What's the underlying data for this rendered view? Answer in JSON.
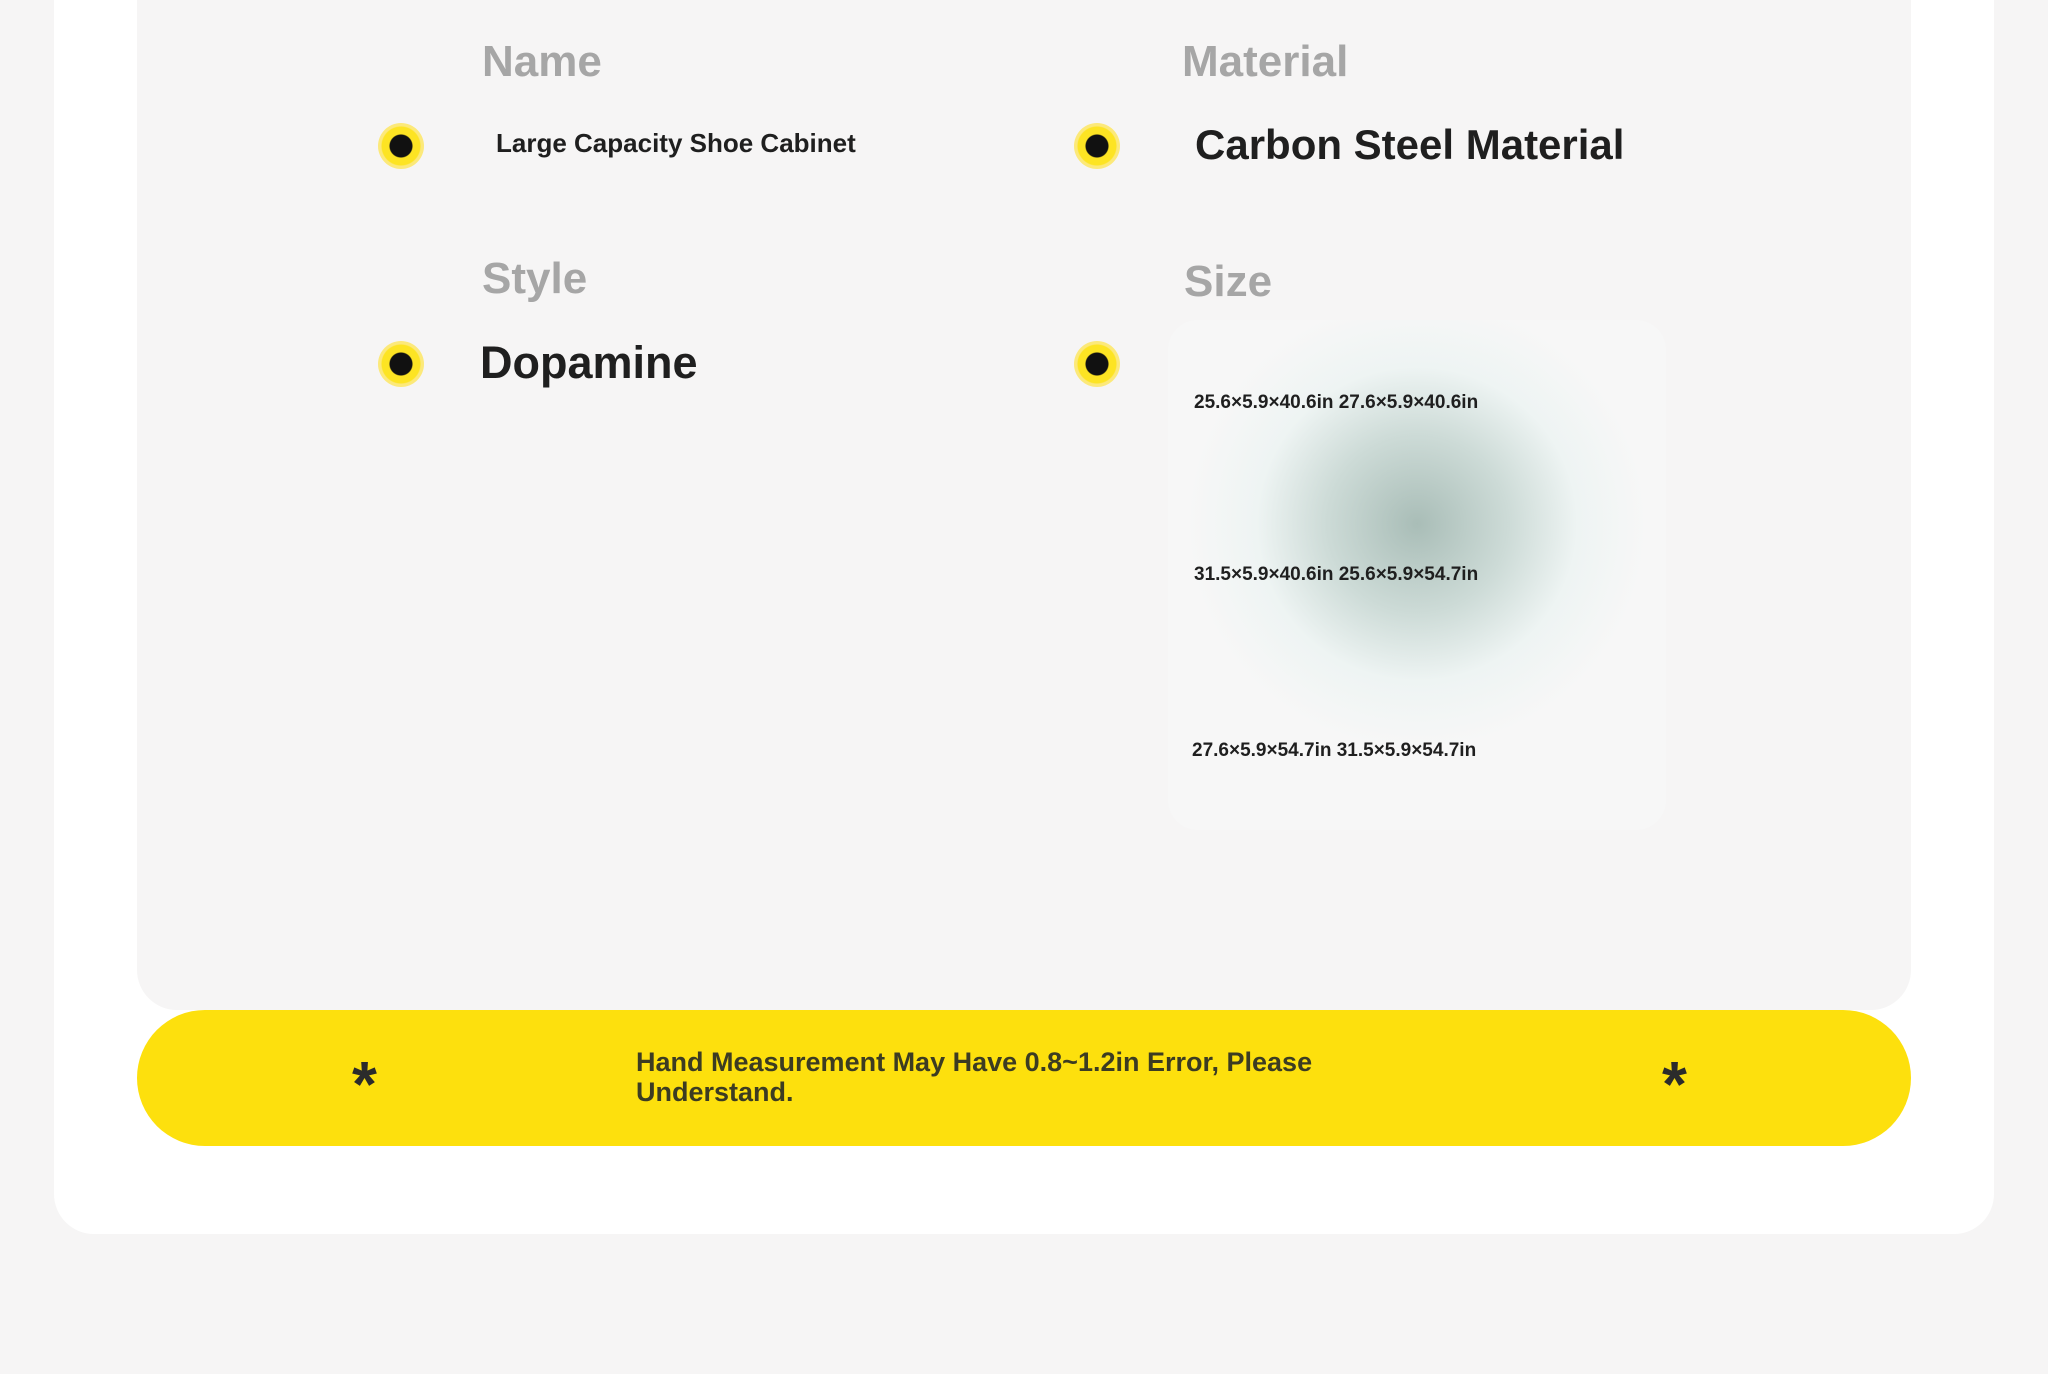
{
  "specs": {
    "name": {
      "label": "Name",
      "value": "Large Capacity Shoe Cabinet"
    },
    "material": {
      "label": "Material",
      "value": "Carbon Steel Material"
    },
    "style": {
      "label": "Style",
      "value": "Dopamine"
    },
    "size": {
      "label": "Size",
      "rows": [
        "25.6×5.9×40.6in 27.6×5.9×40.6in",
        "31.5×5.9×40.6in 25.6×5.9×54.7in",
        "27.6×5.9×54.7in 31.5×5.9×54.7in"
      ]
    }
  },
  "banner": {
    "symbol_left": "*",
    "symbol_right": "*",
    "text": "Hand Measurement May Have 0.8~1.2in Error, Please Understand."
  },
  "colors": {
    "accent": "#fde00d",
    "label": "#a6a6a6",
    "text": "#1f1f1f",
    "background": "#f6f5f5"
  }
}
